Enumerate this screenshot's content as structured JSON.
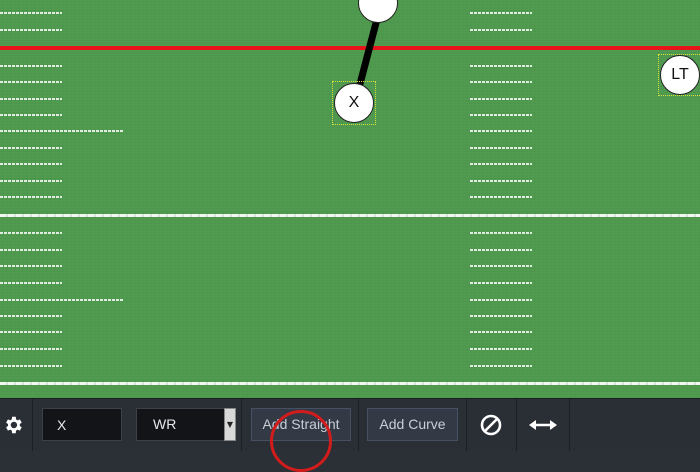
{
  "field": {
    "colors": {
      "grass": "#4f9a4f",
      "line_of_scrimmage": "#e8141a",
      "route": "#000000",
      "selection": "#d8e23a"
    },
    "players": [
      {
        "id": "top",
        "label": ""
      },
      {
        "id": "x",
        "label": "X"
      },
      {
        "id": "lt",
        "label": "LT"
      }
    ]
  },
  "toolbar": {
    "settings_icon": "gear-icon",
    "name_input_value": "X",
    "position_select_value": "WR",
    "add_straight_label": "Add Straight",
    "add_curve_label": "Add Curve",
    "clear_icon": "no-entry-icon",
    "flip_icon": "double-arrow-icon"
  }
}
